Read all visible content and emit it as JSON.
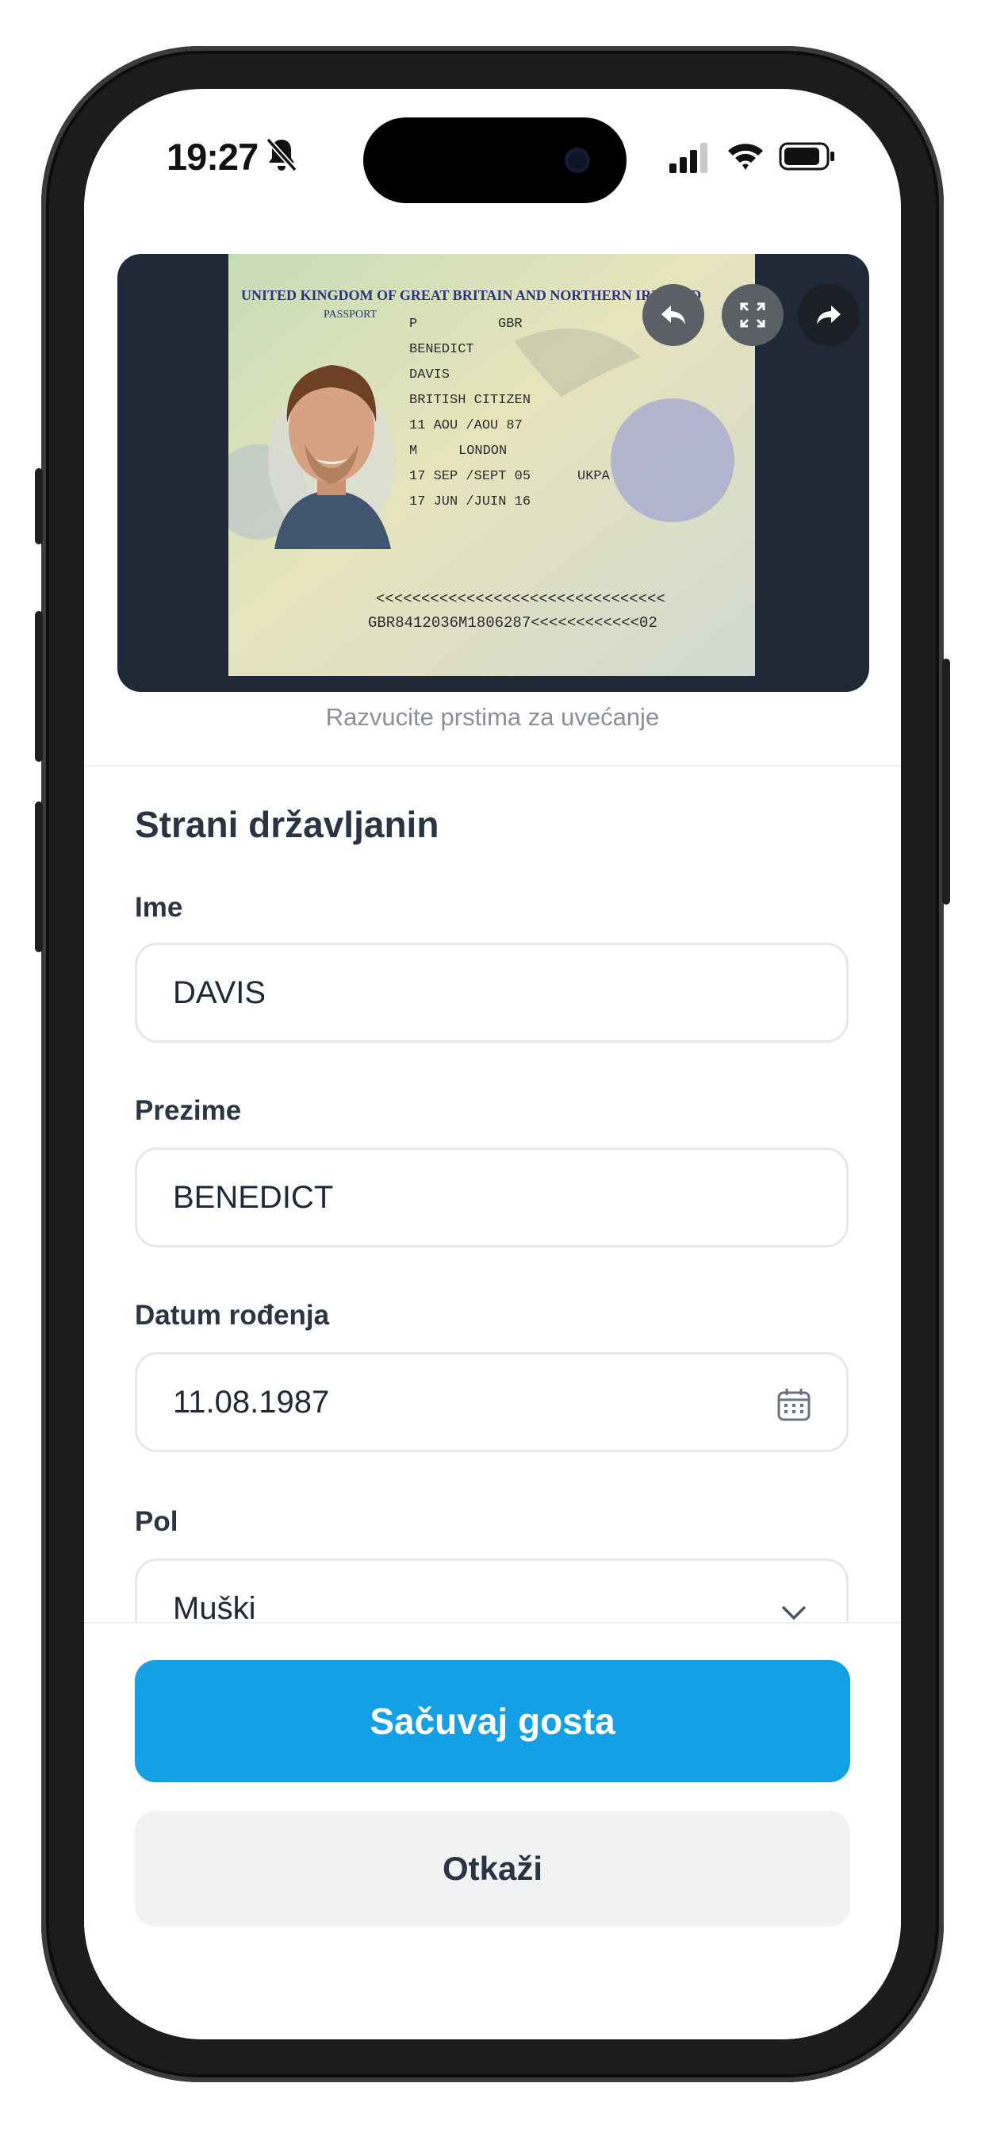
{
  "status_bar": {
    "time": "19:27",
    "icons": [
      "bell-muted-icon",
      "signal-icon",
      "wifi-icon",
      "battery-icon"
    ]
  },
  "passport_viewer": {
    "header_line": "UNITED KINGDOM OF GREAT BRITAIN AND NORTHERN IRELAND",
    "doc_label": "PASSPORT",
    "type": "P",
    "code": "GBR",
    "surname": "BENEDICT",
    "given_names": "DAVIS",
    "nationality": "BRITISH CITIZEN",
    "birth_date": "11 AOU /AOU 87",
    "sex": "M",
    "birth_place": "LONDON",
    "issue_date": "17 SEP /SEPT 05",
    "authority": "UKPA",
    "expiry_date": "17 JUN /JUIN 16",
    "mrz_line1": "<<<<<<<<<<<<<<<<<<<<<<<<<<<<<<<<",
    "mrz_line2": "GBR8412036M1806287<<<<<<<<<<<<02",
    "buttons": [
      "undo-icon",
      "expand-icon",
      "share-icon"
    ],
    "hint": "Razvucite prstima za uvećanje"
  },
  "form": {
    "title": "Strani državljanin",
    "first_name": {
      "label": "Ime",
      "value": "DAVIS"
    },
    "last_name": {
      "label": "Prezime",
      "value": "BENEDICT"
    },
    "birth_date": {
      "label": "Datum rođenja",
      "value": "11.08.1987"
    },
    "gender": {
      "label": "Pol",
      "value": "Muški"
    }
  },
  "actions": {
    "save_label": "Sačuvaj gosta",
    "cancel_label": "Otkaži"
  },
  "colors": {
    "primary": "#14a0e6",
    "text_dark": "#2b3443",
    "viewer_bg": "#1f2937"
  }
}
